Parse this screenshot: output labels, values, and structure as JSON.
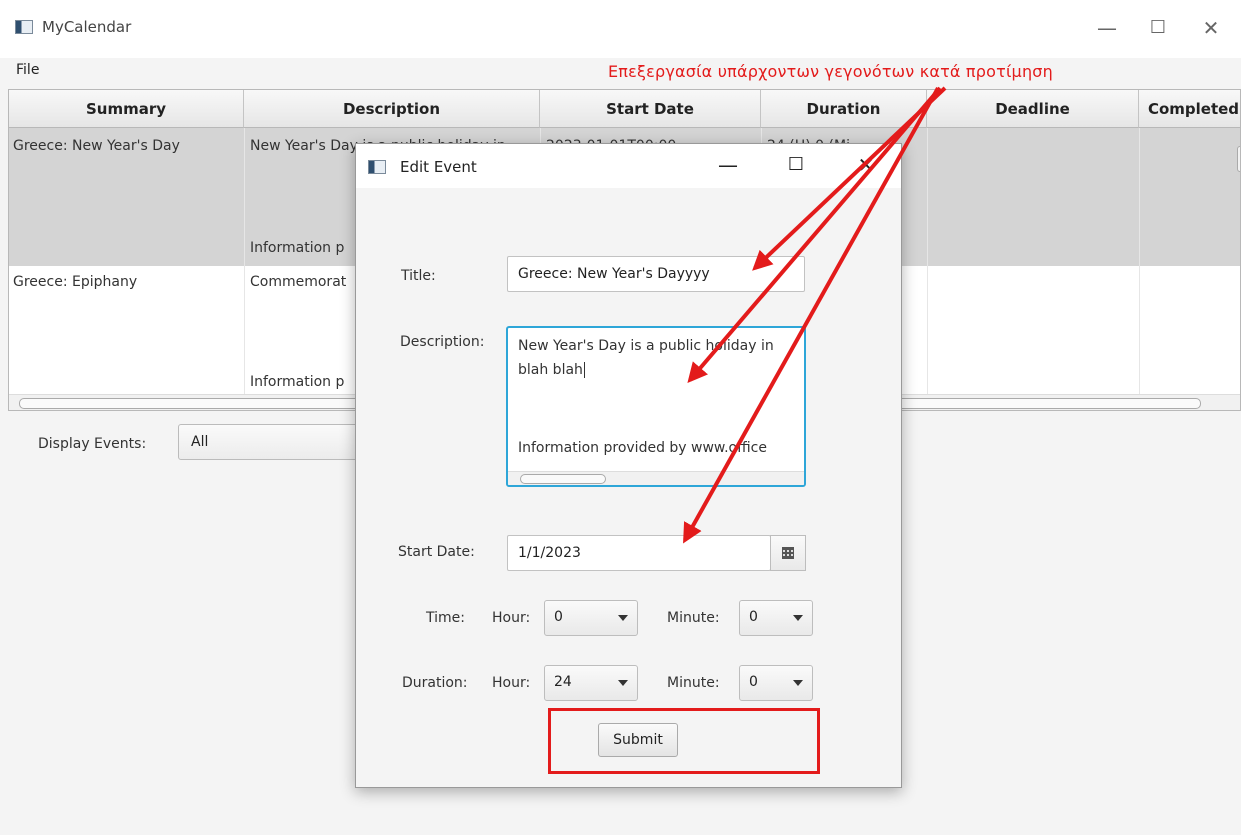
{
  "window": {
    "title": "MyCalendar",
    "minimize": "—",
    "maximize": "☐",
    "close": "✕"
  },
  "menu": {
    "file": "File"
  },
  "annotation": "Επεξεργασία υπάρχοντων γεγονότων κατά προτίμηση",
  "table": {
    "headers": [
      "Summary",
      "Description",
      "Start Date",
      "Duration",
      "Deadline",
      "Completed"
    ],
    "rows": [
      {
        "summary": "Greece: New Year's Day",
        "description_top": "New Year's Day is a public holiday in",
        "description_bottom": "Information p",
        "start": "2023-01-01T00:00",
        "duration": "24 (H) 0 (Mi"
      },
      {
        "summary": "Greece: Epiphany",
        "description_top": "Commemorat",
        "description_bottom": "Information p"
      }
    ]
  },
  "display_events": {
    "label": "Display Events:",
    "value": "All"
  },
  "dialog": {
    "title": "Edit Event",
    "title_label": "Title:",
    "title_value": "Greece: New Year's Dayyyy",
    "description_label": "Description:",
    "description_line1": "New Year's Day is a public holiday in",
    "description_line2": "blah blah",
    "description_line3": "Information provided by www.office",
    "start_date_label": "Start Date:",
    "start_date_value": "1/1/2023",
    "time_label": "Time:",
    "hour_label": "Hour:",
    "minute_label": "Minute:",
    "time_hour": "0",
    "time_minute": "0",
    "duration_label": "Duration:",
    "duration_hour": "24",
    "duration_minute": "0",
    "submit": "Submit"
  },
  "colors": {
    "annotation": "#e31b1b",
    "selected_row": "#d4d4d4",
    "focus": "#2ea6d8"
  }
}
